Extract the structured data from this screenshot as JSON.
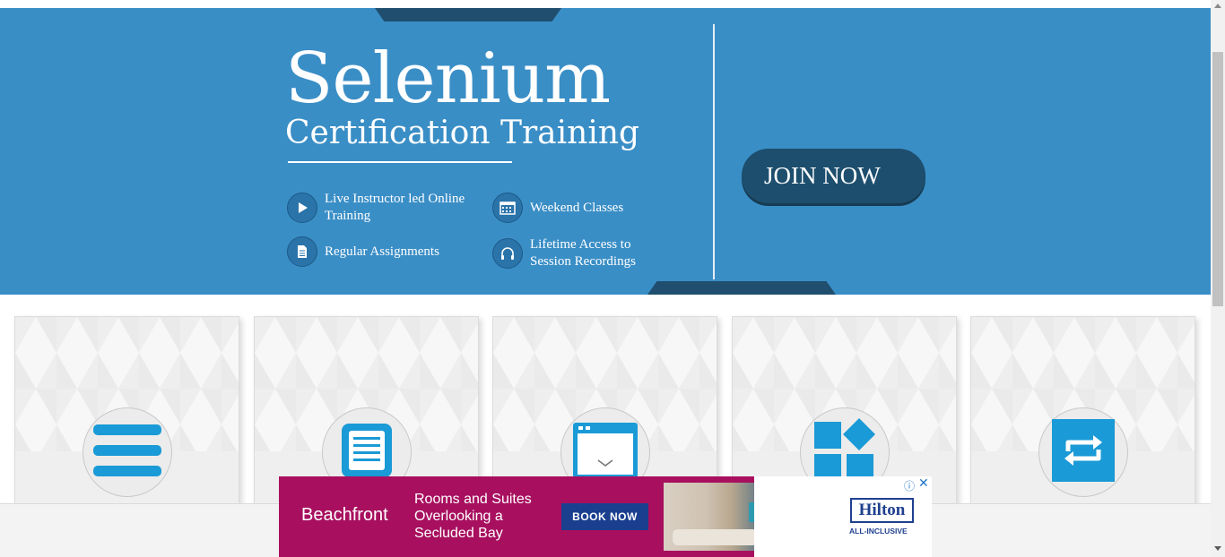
{
  "banner": {
    "title": "Selenium",
    "subtitle": "Certification Training",
    "features": [
      {
        "icon": "play-icon",
        "text": "Live Instructor led Online Training"
      },
      {
        "icon": "calendar-icon",
        "text": "Weekend Classes"
      },
      {
        "icon": "document-icon",
        "text": "Regular Assignments"
      },
      {
        "icon": "headphones-icon",
        "text": "Lifetime Access to Session Recordings"
      }
    ],
    "join_label": "JOIN NOW",
    "colors": {
      "background": "#3a8ec6",
      "dark": "#1d4e6d"
    }
  },
  "cards": [
    {
      "icon": "menu-lines-icon"
    },
    {
      "icon": "notepad-icon"
    },
    {
      "icon": "browser-window-icon"
    },
    {
      "icon": "blocks-icon"
    },
    {
      "icon": "repeat-icon"
    }
  ],
  "ad": {
    "brand": "Beachfront",
    "headline": "Rooms and Suites Overlooking a Secluded Bay",
    "cta": "BOOK NOW",
    "logo": "Hilton",
    "logo_sub": "ALL-INCLUSIVE",
    "choices_icon": "ⓘ",
    "close_icon": "✕",
    "colors": {
      "background": "#a8105f",
      "button": "#1a3f8f",
      "logo": "#1f3f8f"
    }
  },
  "icon_color": "#1a9ad6"
}
